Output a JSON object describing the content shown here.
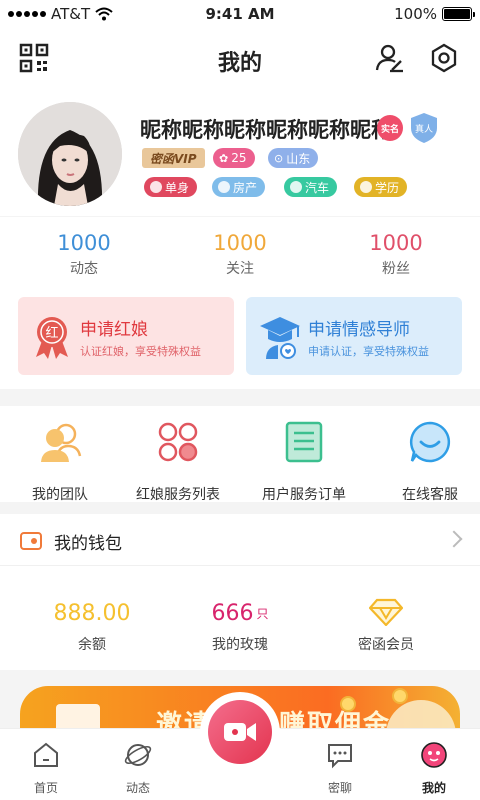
{
  "status_bar": {
    "carrier": "AT&T",
    "time": "9:41 AM",
    "battery": "100%"
  },
  "header": {
    "title": "我的",
    "icons": [
      "qr-code-icon",
      "edit-profile-icon",
      "settings-icon"
    ]
  },
  "profile": {
    "nickname": "昵称昵称昵称昵称昵称昵称",
    "badge_realname": "实名",
    "badge_verified": "真人",
    "vip": "密函VIP",
    "level": "25",
    "location": "山东",
    "tags": [
      "单身",
      "房产",
      "汽车",
      "学历"
    ]
  },
  "stats": [
    {
      "value": "1000",
      "label": "动态",
      "color": "#3f8fd7"
    },
    {
      "value": "1000",
      "label": "关注",
      "color": "#f0a83a"
    },
    {
      "value": "1000",
      "label": "粉丝",
      "color": "#e0506a"
    }
  ],
  "apply_cards": [
    {
      "title": "申请红娘",
      "subtitle": "认证红娘，享受特殊权益",
      "icon_text": "红"
    },
    {
      "title": "申请情感导师",
      "subtitle": "申请认证，享受特殊权益"
    }
  ],
  "services": [
    {
      "label": "我的团队"
    },
    {
      "label": "红娘服务列表"
    },
    {
      "label": "用户服务订单"
    },
    {
      "label": "在线客服"
    }
  ],
  "wallet": {
    "title": "我的钱包",
    "balance": {
      "value": "888.00",
      "label": "余额"
    },
    "roses": {
      "value": "666",
      "unit": "只",
      "label": "我的玫瑰"
    },
    "member": {
      "label": "密函会员"
    }
  },
  "banner": {
    "text": "邀请好友 赚取佣金"
  },
  "tabbar": [
    {
      "label": "首页"
    },
    {
      "label": "动态"
    },
    {
      "label": "密聊"
    },
    {
      "label": "我的"
    }
  ],
  "colors": {
    "accent": "#e3344f",
    "blue": "#3f8fd7",
    "gold": "#f0a83a"
  }
}
